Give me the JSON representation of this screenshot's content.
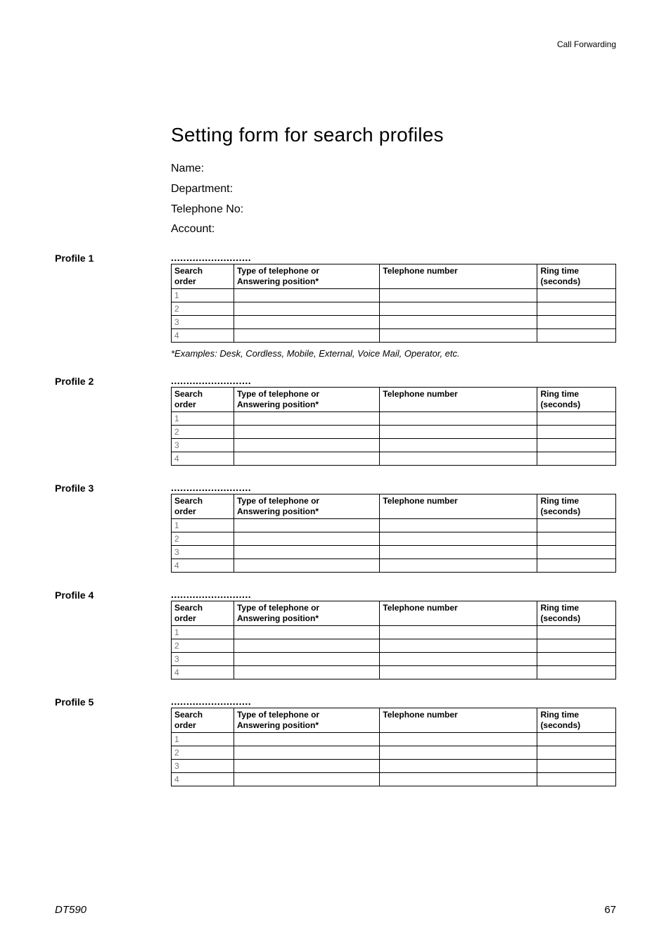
{
  "header": {
    "section": "Call Forwarding"
  },
  "title": "Setting form for search profiles",
  "fields": {
    "name_label": "Name:",
    "department_label": "Department:",
    "telephone_label": "Telephone No:",
    "account_label": "Account:"
  },
  "table_headers": {
    "order": "Search order",
    "type": "Type of telephone or Answering position*",
    "tel": "Telephone number",
    "ring": "Ring time (seconds)"
  },
  "dots": "..........................",
  "profiles": [
    {
      "label": "Profile 1",
      "rows": [
        "1",
        "2",
        "3",
        "4"
      ],
      "note": "*Examples: Desk, Cordless, Mobile, External, Voice Mail, Operator, etc."
    },
    {
      "label": "Profile 2",
      "rows": [
        "1",
        "2",
        "3",
        "4"
      ]
    },
    {
      "label": "Profile 3",
      "rows": [
        "1",
        "2",
        "3",
        "4"
      ]
    },
    {
      "label": "Profile 4",
      "rows": [
        "1",
        "2",
        "3",
        "4"
      ]
    },
    {
      "label": "Profile 5",
      "rows": [
        "1",
        "2",
        "3",
        "4"
      ]
    }
  ],
  "footer": {
    "model": "DT590",
    "page": "67"
  }
}
